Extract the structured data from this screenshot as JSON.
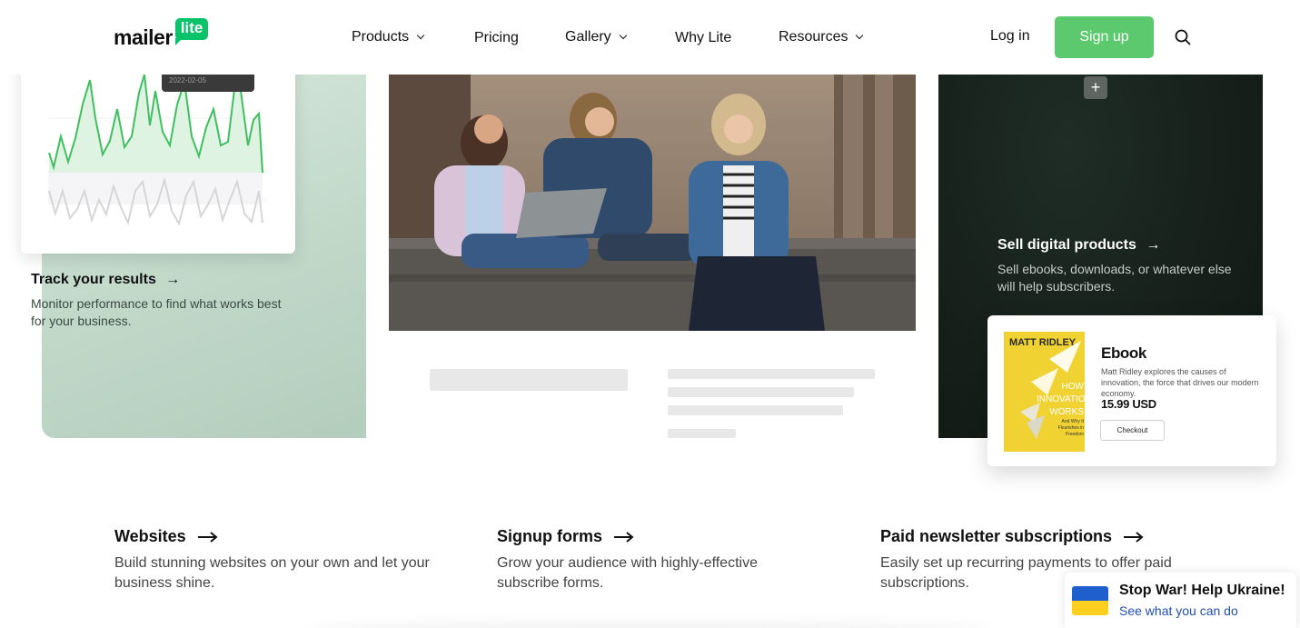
{
  "header": {
    "logo_text": "mailer",
    "logo_badge": "lite",
    "nav": [
      {
        "label": "Products",
        "has_dropdown": true
      },
      {
        "label": "Pricing",
        "has_dropdown": false
      },
      {
        "label": "Gallery",
        "has_dropdown": true
      },
      {
        "label": "Why Lite",
        "has_dropdown": false
      },
      {
        "label": "Resources",
        "has_dropdown": true
      }
    ],
    "login_label": "Log in",
    "signup_label": "Sign up",
    "search_icon": "search-icon",
    "accent_color": "#5cc96e"
  },
  "track": {
    "title": "Track your results",
    "description": "Monitor performance to find what works best for your business.",
    "tooltip_date": "2022-02-05"
  },
  "sell": {
    "title": "Sell digital products",
    "description": "Sell ebooks, downloads, or whatever else will help subscribers.",
    "plus_label": "+",
    "ebook": {
      "name": "Ebook",
      "description": "Matt Ridley explores the causes of innovation, the force that drives our modern economy.",
      "price": "15.99 USD",
      "checkout_label": "Checkout",
      "book_author": "MATT RIDLEY",
      "book_title": "HOW INNOVATION WORKS",
      "book_subtitle": "And Why It Flourishes in Freedom"
    }
  },
  "features": [
    {
      "title": "Websites",
      "description": "Build stunning websites on your own and let your business shine."
    },
    {
      "title": "Signup forms",
      "description": "Grow your audience with highly-effective subscribe forms."
    },
    {
      "title": "Paid newsletter subscriptions",
      "description": "Easily set up recurring payments to offer paid subscriptions."
    }
  ],
  "ukraine": {
    "title": "Stop War! Help Ukraine!",
    "link": "See what you can do"
  },
  "arrow_glyph": "→"
}
